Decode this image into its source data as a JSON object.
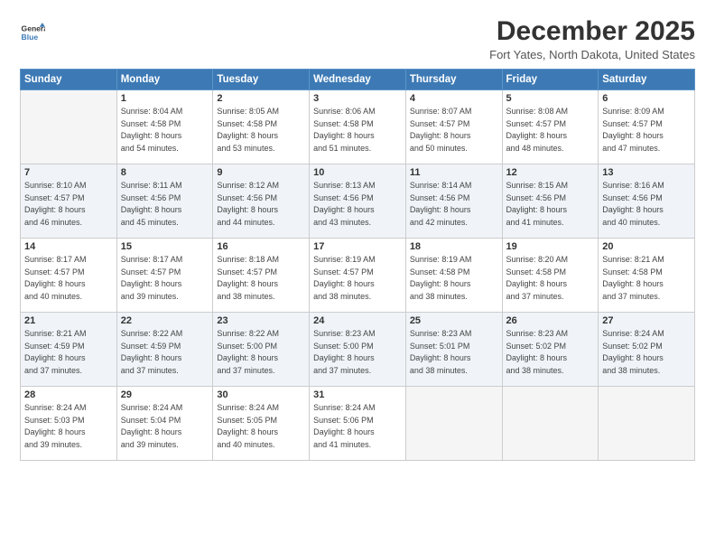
{
  "logo": {
    "line1": "General",
    "line2": "Blue"
  },
  "title": "December 2025",
  "subtitle": "Fort Yates, North Dakota, United States",
  "days_of_week": [
    "Sunday",
    "Monday",
    "Tuesday",
    "Wednesday",
    "Thursday",
    "Friday",
    "Saturday"
  ],
  "weeks": [
    [
      {
        "day": "",
        "sunrise": "",
        "sunset": "",
        "daylight": ""
      },
      {
        "day": "1",
        "sunrise": "8:04 AM",
        "sunset": "4:58 PM",
        "daylight": "8 hours and 54 minutes."
      },
      {
        "day": "2",
        "sunrise": "8:05 AM",
        "sunset": "4:58 PM",
        "daylight": "8 hours and 53 minutes."
      },
      {
        "day": "3",
        "sunrise": "8:06 AM",
        "sunset": "4:58 PM",
        "daylight": "8 hours and 51 minutes."
      },
      {
        "day": "4",
        "sunrise": "8:07 AM",
        "sunset": "4:57 PM",
        "daylight": "8 hours and 50 minutes."
      },
      {
        "day": "5",
        "sunrise": "8:08 AM",
        "sunset": "4:57 PM",
        "daylight": "8 hours and 48 minutes."
      },
      {
        "day": "6",
        "sunrise": "8:09 AM",
        "sunset": "4:57 PM",
        "daylight": "8 hours and 47 minutes."
      }
    ],
    [
      {
        "day": "7",
        "sunrise": "8:10 AM",
        "sunset": "4:57 PM",
        "daylight": "8 hours and 46 minutes."
      },
      {
        "day": "8",
        "sunrise": "8:11 AM",
        "sunset": "4:56 PM",
        "daylight": "8 hours and 45 minutes."
      },
      {
        "day": "9",
        "sunrise": "8:12 AM",
        "sunset": "4:56 PM",
        "daylight": "8 hours and 44 minutes."
      },
      {
        "day": "10",
        "sunrise": "8:13 AM",
        "sunset": "4:56 PM",
        "daylight": "8 hours and 43 minutes."
      },
      {
        "day": "11",
        "sunrise": "8:14 AM",
        "sunset": "4:56 PM",
        "daylight": "8 hours and 42 minutes."
      },
      {
        "day": "12",
        "sunrise": "8:15 AM",
        "sunset": "4:56 PM",
        "daylight": "8 hours and 41 minutes."
      },
      {
        "day": "13",
        "sunrise": "8:16 AM",
        "sunset": "4:56 PM",
        "daylight": "8 hours and 40 minutes."
      }
    ],
    [
      {
        "day": "14",
        "sunrise": "8:17 AM",
        "sunset": "4:57 PM",
        "daylight": "8 hours and 40 minutes."
      },
      {
        "day": "15",
        "sunrise": "8:17 AM",
        "sunset": "4:57 PM",
        "daylight": "8 hours and 39 minutes."
      },
      {
        "day": "16",
        "sunrise": "8:18 AM",
        "sunset": "4:57 PM",
        "daylight": "8 hours and 38 minutes."
      },
      {
        "day": "17",
        "sunrise": "8:19 AM",
        "sunset": "4:57 PM",
        "daylight": "8 hours and 38 minutes."
      },
      {
        "day": "18",
        "sunrise": "8:19 AM",
        "sunset": "4:58 PM",
        "daylight": "8 hours and 38 minutes."
      },
      {
        "day": "19",
        "sunrise": "8:20 AM",
        "sunset": "4:58 PM",
        "daylight": "8 hours and 37 minutes."
      },
      {
        "day": "20",
        "sunrise": "8:21 AM",
        "sunset": "4:58 PM",
        "daylight": "8 hours and 37 minutes."
      }
    ],
    [
      {
        "day": "21",
        "sunrise": "8:21 AM",
        "sunset": "4:59 PM",
        "daylight": "8 hours and 37 minutes."
      },
      {
        "day": "22",
        "sunrise": "8:22 AM",
        "sunset": "4:59 PM",
        "daylight": "8 hours and 37 minutes."
      },
      {
        "day": "23",
        "sunrise": "8:22 AM",
        "sunset": "5:00 PM",
        "daylight": "8 hours and 37 minutes."
      },
      {
        "day": "24",
        "sunrise": "8:23 AM",
        "sunset": "5:00 PM",
        "daylight": "8 hours and 37 minutes."
      },
      {
        "day": "25",
        "sunrise": "8:23 AM",
        "sunset": "5:01 PM",
        "daylight": "8 hours and 38 minutes."
      },
      {
        "day": "26",
        "sunrise": "8:23 AM",
        "sunset": "5:02 PM",
        "daylight": "8 hours and 38 minutes."
      },
      {
        "day": "27",
        "sunrise": "8:24 AM",
        "sunset": "5:02 PM",
        "daylight": "8 hours and 38 minutes."
      }
    ],
    [
      {
        "day": "28",
        "sunrise": "8:24 AM",
        "sunset": "5:03 PM",
        "daylight": "8 hours and 39 minutes."
      },
      {
        "day": "29",
        "sunrise": "8:24 AM",
        "sunset": "5:04 PM",
        "daylight": "8 hours and 39 minutes."
      },
      {
        "day": "30",
        "sunrise": "8:24 AM",
        "sunset": "5:05 PM",
        "daylight": "8 hours and 40 minutes."
      },
      {
        "day": "31",
        "sunrise": "8:24 AM",
        "sunset": "5:06 PM",
        "daylight": "8 hours and 41 minutes."
      },
      {
        "day": "",
        "sunrise": "",
        "sunset": "",
        "daylight": ""
      },
      {
        "day": "",
        "sunrise": "",
        "sunset": "",
        "daylight": ""
      },
      {
        "day": "",
        "sunrise": "",
        "sunset": "",
        "daylight": ""
      }
    ]
  ],
  "labels": {
    "sunrise_prefix": "Sunrise: ",
    "sunset_prefix": "Sunset: ",
    "daylight_prefix": "Daylight: "
  }
}
